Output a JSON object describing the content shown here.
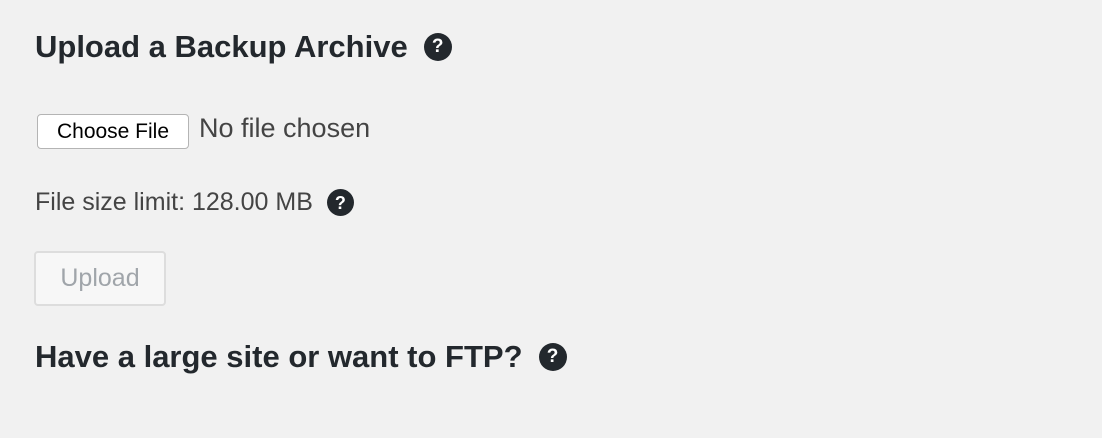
{
  "upload_section": {
    "title": "Upload a Backup Archive",
    "help_icon": "question-circle-icon",
    "file_input": {
      "button_label": "Choose File",
      "status": "No file chosen"
    },
    "size_limit_text": "File size limit: 128.00 MB",
    "upload_button_label": "Upload",
    "upload_button_disabled": true
  },
  "ftp_section": {
    "title": "Have a large site or want to FTP?",
    "help_icon": "question-circle-icon"
  },
  "colors": {
    "background": "#f1f1f1",
    "heading_text": "#23282d",
    "body_text": "#444444",
    "disabled_text": "#a0a5aa"
  }
}
